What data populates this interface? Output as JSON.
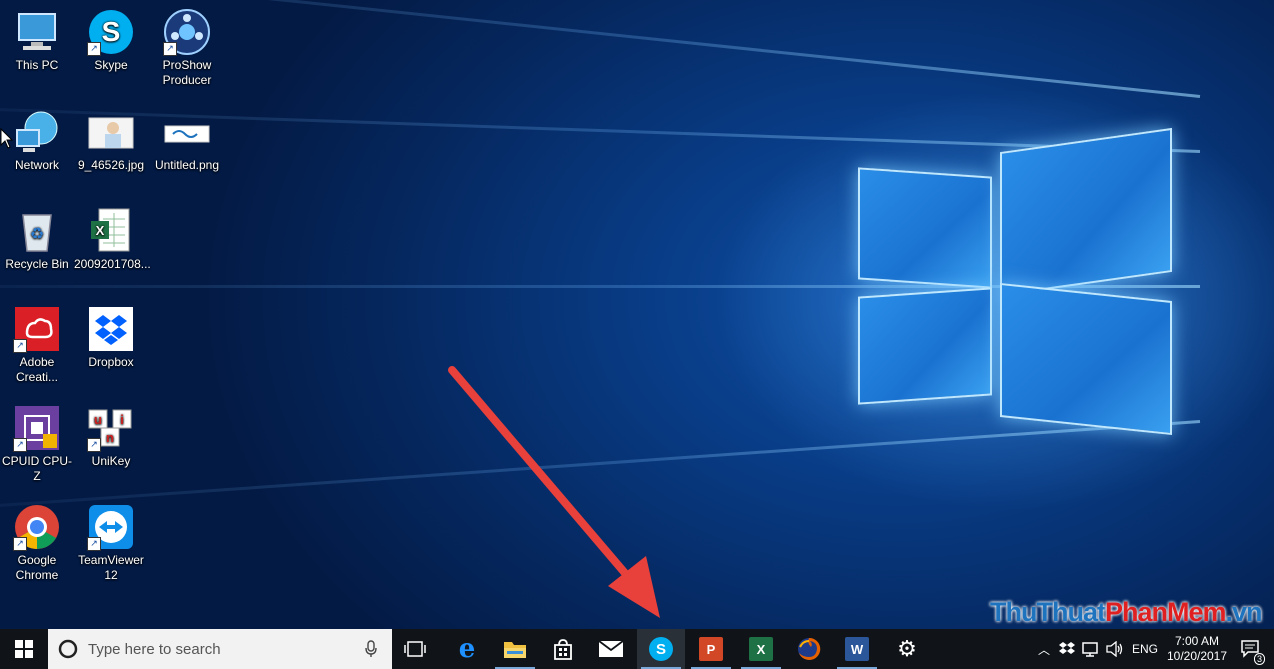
{
  "desktop": {
    "icons": [
      {
        "label": "This PC",
        "icon": "computer-icon"
      },
      {
        "label": "Skype",
        "icon": "skype-icon"
      },
      {
        "label": "ProShow Producer",
        "icon": "proshow-icon"
      },
      {
        "label": "Network",
        "icon": "network-icon"
      },
      {
        "label": "9_46526.jpg",
        "icon": "image-file-icon"
      },
      {
        "label": "Untitled.png",
        "icon": "image-file-icon"
      },
      {
        "label": "Recycle Bin",
        "icon": "recycle-bin-icon"
      },
      {
        "label": "2009201708...",
        "icon": "excel-file-icon"
      },
      {
        "label": "Adobe Creati...",
        "icon": "adobe-cc-icon"
      },
      {
        "label": "Dropbox",
        "icon": "dropbox-icon"
      },
      {
        "label": "CPUID CPU-Z",
        "icon": "cpuz-icon"
      },
      {
        "label": "UniKey",
        "icon": "unikey-icon"
      },
      {
        "label": "Google Chrome",
        "icon": "chrome-icon"
      },
      {
        "label": "TeamViewer 12",
        "icon": "teamviewer-icon"
      }
    ],
    "unikey_letters": [
      "u",
      "n",
      "i"
    ]
  },
  "taskbar": {
    "search_placeholder": "Type here to search",
    "pinned": [
      {
        "name": "task-view",
        "icon": "task-view-icon"
      },
      {
        "name": "edge",
        "icon": "edge-icon",
        "glyph": "e",
        "color": "#1e90ff"
      },
      {
        "name": "file-explorer",
        "icon": "folder-icon",
        "color": "#f0c040"
      },
      {
        "name": "store",
        "icon": "store-icon"
      },
      {
        "name": "mail",
        "icon": "mail-icon"
      },
      {
        "name": "skype",
        "icon": "skype-icon",
        "glyph": "S",
        "color": "#00aff0"
      },
      {
        "name": "powerpoint",
        "icon": "powerpoint-icon",
        "glyph": "P",
        "color": "#d24726"
      },
      {
        "name": "excel",
        "icon": "excel-icon",
        "glyph": "X",
        "color": "#1e7145"
      },
      {
        "name": "firefox",
        "icon": "firefox-icon",
        "color": "#e66000"
      },
      {
        "name": "word",
        "icon": "word-icon",
        "glyph": "W",
        "color": "#2b579a"
      },
      {
        "name": "settings",
        "icon": "gear-icon",
        "glyph": "⚙"
      }
    ],
    "tray": {
      "language": "ENG",
      "time": "7:00 AM",
      "date": "10/20/2017",
      "notification_count": "3"
    }
  },
  "watermark": {
    "part1": "ThuThuat",
    "part2": "PhanMem",
    "part3": ".vn",
    "colors": {
      "part1": "#1e73be",
      "part2": "#e02020",
      "part3": "#1e73be"
    }
  },
  "colors": {
    "arrow": "#e8403a",
    "taskbar": "#101418"
  }
}
